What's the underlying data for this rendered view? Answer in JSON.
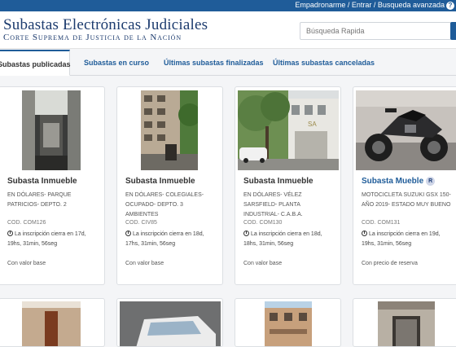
{
  "topbar": {
    "register": "Empadronarme",
    "enter": "Entrar",
    "advanced_search": "Busqueda avanzada",
    "help_icon": "?"
  },
  "header": {
    "title": "Subastas Electrónicas Judiciales",
    "subtitle": "Corte Suprema de Justicia de la Nación",
    "search_placeholder": "Búsqueda Rapida"
  },
  "tabs": [
    {
      "label": "Subastas publicadas",
      "active": true
    },
    {
      "label": "Subastas en curso",
      "active": false
    },
    {
      "label": "Últimas subastas finalizadas",
      "active": false
    },
    {
      "label": "Últimas subastas canceladas",
      "active": false
    }
  ],
  "cards": [
    {
      "title": "Subasta Inmueble",
      "description": "EN DÓLARES- PARQUE PATRICIOS- DEPTO. 2",
      "code": "COD. COM126",
      "closing": "La inscripción cierra en 17d, 19hs, 31min, 56seg",
      "base": "Con valor base"
    },
    {
      "title": "Subasta Inmueble",
      "description": "EN DÓLARES- COLEGIALES- OCUPADO- DEPTO. 3 AMBIENTES",
      "code": "COD. CIV85",
      "closing": "La inscripción cierra en 18d, 17hs, 31min, 56seg",
      "base": "Con valor base"
    },
    {
      "title": "Subasta Inmueble",
      "description": "EN DÓLARES- VÉLEZ SARSFIELD- PLANTA INDUSTRIAL- C.A.B.A.",
      "code": "COD. COM130",
      "closing": "La inscripción cierra en 18d, 18hs, 31min, 56seg",
      "base": "Con valor base"
    },
    {
      "title": "Subasta Mueble",
      "badge": "R",
      "description": "MOTOCICLETA SUZUKI GSX 150- AÑO 2019- ESTADO MUY BUENO",
      "code": "COD. COM131",
      "closing": "La inscripción cierra en 19d, 19hs, 31min, 56seg",
      "base": "Con precio de reserva"
    }
  ],
  "colors": {
    "brand_blue": "#1f5c99",
    "title_navy": "#1c3b6e"
  }
}
